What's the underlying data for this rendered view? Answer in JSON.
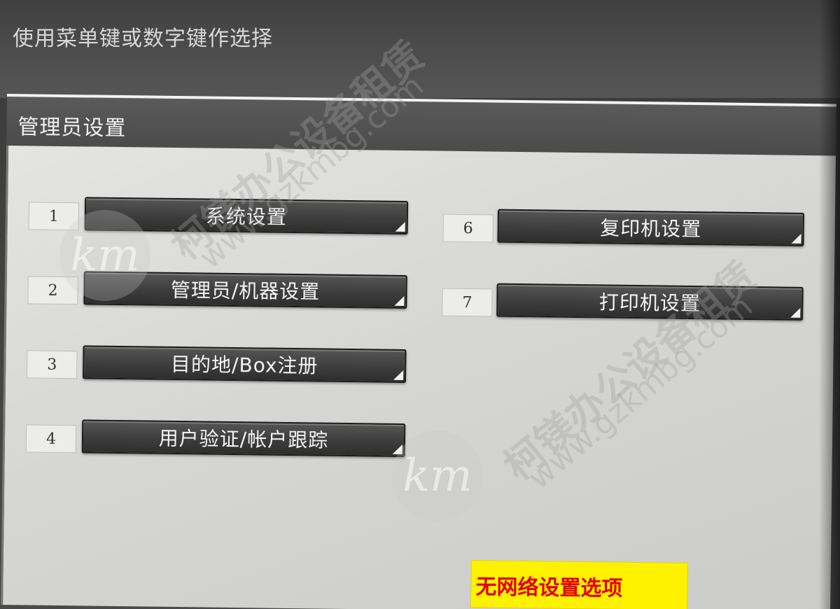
{
  "instruction": "使用菜单键或数字键作选择",
  "panel": {
    "title": "管理员设置"
  },
  "menu": {
    "left": [
      {
        "number": "1",
        "label": "系统设置"
      },
      {
        "number": "2",
        "label": "管理员/机器设置"
      },
      {
        "number": "3",
        "label": "目的地/Box注册"
      },
      {
        "number": "4",
        "label": "用户验证/帐户跟踪"
      }
    ],
    "right": [
      {
        "number": "6",
        "label": "复印机设置"
      },
      {
        "number": "7",
        "label": "打印机设置"
      }
    ]
  },
  "annotation": {
    "text": "无网络设置选项",
    "background": "#fff200",
    "color": "#e00000"
  },
  "watermark": {
    "brand": "柯镁办公设备租赁",
    "url": "www.gzkmbg.com",
    "logo": "km"
  }
}
